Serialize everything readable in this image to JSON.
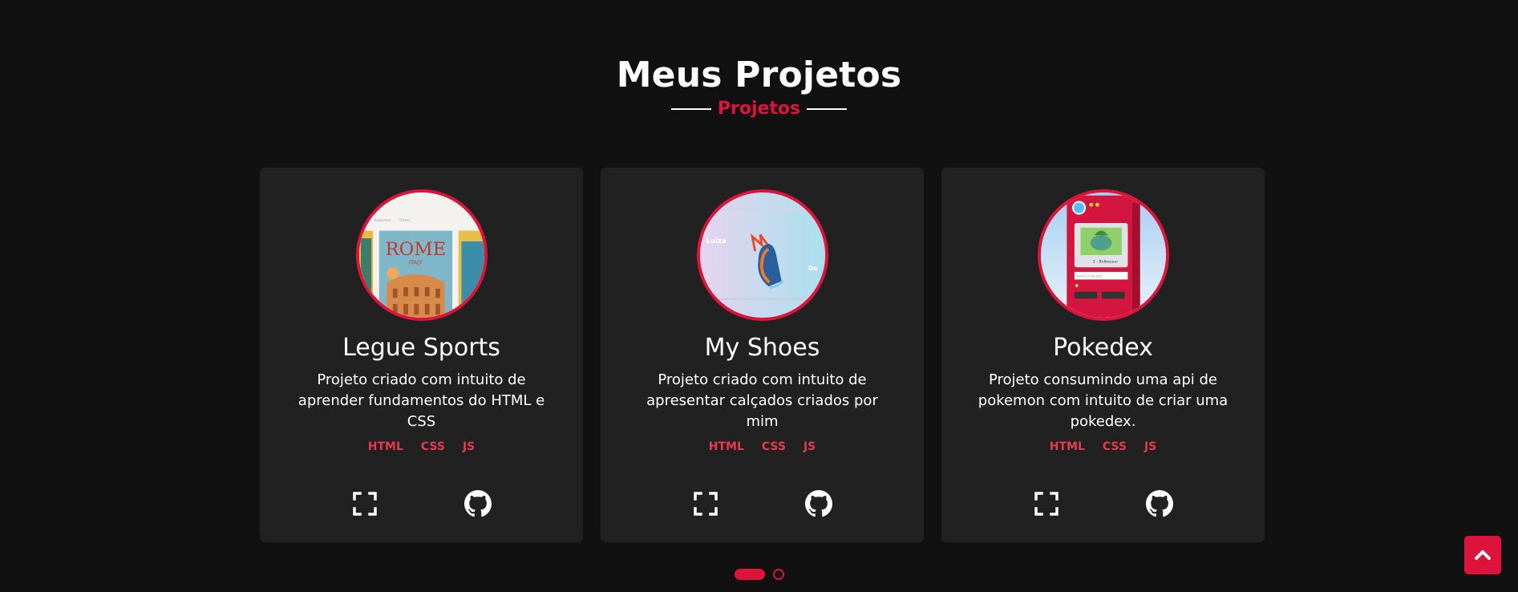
{
  "section": {
    "title": "Meus Projetos",
    "subtitle": "Projetos"
  },
  "projects": [
    {
      "title": "Legue Sports",
      "description": "Projeto criado com intuito de aprender fundamentos do HTML e CSS",
      "tags": [
        "HTML",
        "CSS",
        "JS"
      ],
      "thumb_text": "ROME",
      "thumb_subtext": "ITALY"
    },
    {
      "title": "My Shoes",
      "description": "Projeto criado com intuito de apresentar calçados criados por mim",
      "tags": [
        "HTML",
        "CSS",
        "JS"
      ],
      "thumb_text": "Luiza"
    },
    {
      "title": "Pokedex",
      "description": "Projeto consumindo uma api de pokemon com intuito de criar uma pokedex.",
      "tags": [
        "HTML",
        "CSS",
        "JS"
      ]
    }
  ],
  "icons": {
    "preview": "fullscreen-icon",
    "repo": "github-icon",
    "back_to_top": "chevron-up-icon"
  },
  "colors": {
    "accent": "#dc143c",
    "tag": "#e8394f",
    "card_bg": "#212121",
    "page_bg": "#111111"
  }
}
